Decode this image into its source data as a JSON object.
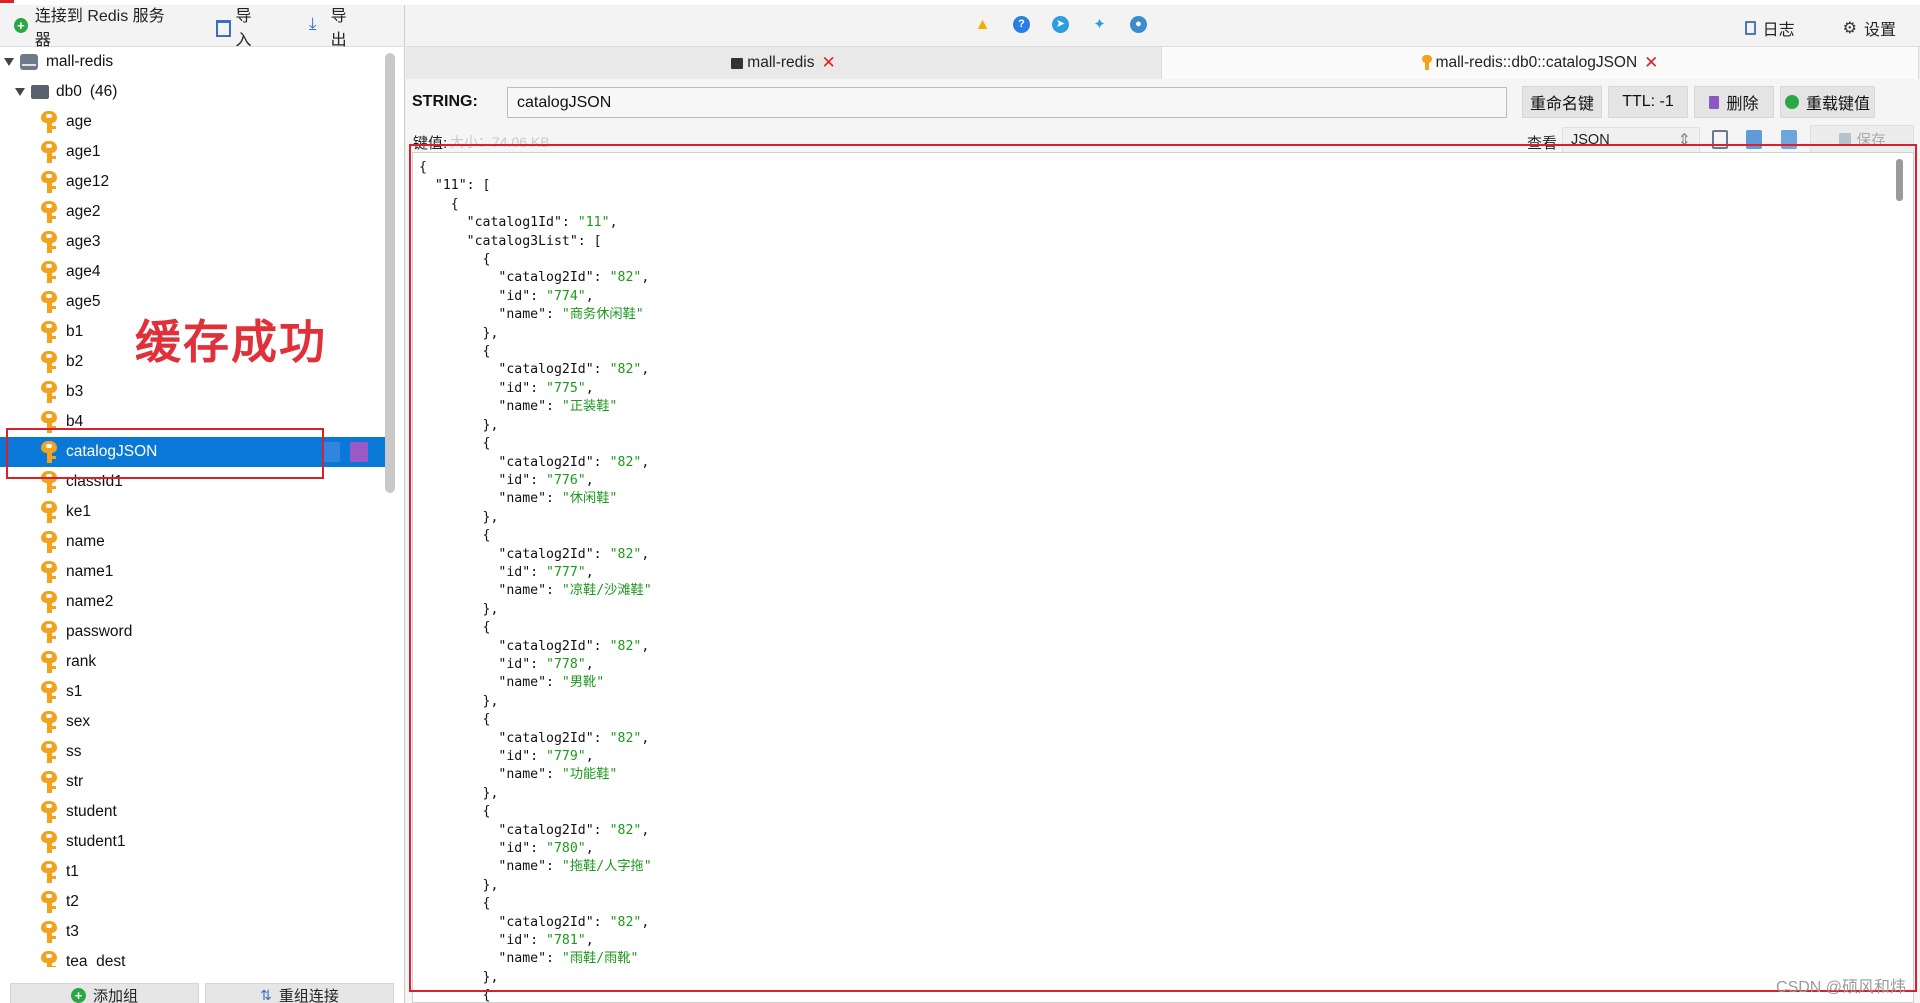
{
  "left_toolbar": {
    "connect_label": "连接到 Redis 服务器",
    "import_label": "导入",
    "export_label": "导出"
  },
  "tree": {
    "server_name": "mall-redis",
    "db_name": "db0",
    "db_count": "(46)",
    "keys": [
      "age",
      "age1",
      "age12",
      "age2",
      "age3",
      "age4",
      "age5",
      "b1",
      "b2",
      "b3",
      "b4",
      "catalogJSON",
      "classId1",
      "ke1",
      "name",
      "name1",
      "name2",
      "password",
      "rank",
      "s1",
      "sex",
      "ss",
      "str",
      "student",
      "student1",
      "t1",
      "t2",
      "t3",
      "tea_dest"
    ],
    "selected_key": "catalogJSON"
  },
  "annotation": {
    "text": "缓存成功"
  },
  "left_bottom": {
    "add_group_label": "添加组",
    "reconnect_label": "重组连接"
  },
  "right_toolbar": {
    "log_label": "日志",
    "settings_label": "设置"
  },
  "tabs": [
    {
      "label": "mall-redis"
    },
    {
      "label": "mall-redis::db0::catalogJSON"
    }
  ],
  "key_header": {
    "type_label": "STRING:",
    "key_name": "catalogJSON",
    "rename_label": "重命名键",
    "ttl_label": "TTL: -1",
    "delete_label": "删除",
    "reload_label": "重载键值"
  },
  "value_bar": {
    "value_label": "键值:",
    "size_label": "大小：74.06 KB",
    "view_label": "查看",
    "view_mode": "JSON",
    "save_label": "保存"
  },
  "code_lines": [
    "{",
    "  \"11\": [",
    "    {",
    "      \"catalog1Id\": \"11\",",
    "      \"catalog3List\": [",
    "        {",
    "          \"catalog2Id\": \"82\",",
    "          \"id\": \"774\",",
    "          \"name\": \"商务休闲鞋\"",
    "        },",
    "        {",
    "          \"catalog2Id\": \"82\",",
    "          \"id\": \"775\",",
    "          \"name\": \"正装鞋\"",
    "        },",
    "        {",
    "          \"catalog2Id\": \"82\",",
    "          \"id\": \"776\",",
    "          \"name\": \"休闲鞋\"",
    "        },",
    "        {",
    "          \"catalog2Id\": \"82\",",
    "          \"id\": \"777\",",
    "          \"name\": \"凉鞋/沙滩鞋\"",
    "        },",
    "        {",
    "          \"catalog2Id\": \"82\",",
    "          \"id\": \"778\",",
    "          \"name\": \"男靴\"",
    "        },",
    "        {",
    "          \"catalog2Id\": \"82\",",
    "          \"id\": \"779\",",
    "          \"name\": \"功能鞋\"",
    "        },",
    "        {",
    "          \"catalog2Id\": \"82\",",
    "          \"id\": \"780\",",
    "          \"name\": \"拖鞋/人字拖\"",
    "        },",
    "        {",
    "          \"catalog2Id\": \"82\",",
    "          \"id\": \"781\",",
    "          \"name\": \"雨鞋/雨靴\"",
    "        },",
    "        {"
  ],
  "watermark": "CSDN @硕风和炜",
  "colors": {
    "selection": "#0a78d7",
    "annotation_red": "#d9202c",
    "json_string": "#1d9a1d",
    "key_icon": "#f2a21b"
  },
  "icons": [
    "plus-circle-icon",
    "import-icon",
    "export-icon",
    "server-icon",
    "database-icon",
    "key-icon",
    "edit-icon",
    "trash-icon",
    "warning-icon",
    "help-icon",
    "telegram-icon",
    "twitter-icon",
    "github-icon",
    "log-icon",
    "gear-icon",
    "terminal-icon",
    "reload-icon",
    "copy-icon",
    "save-icon"
  ]
}
